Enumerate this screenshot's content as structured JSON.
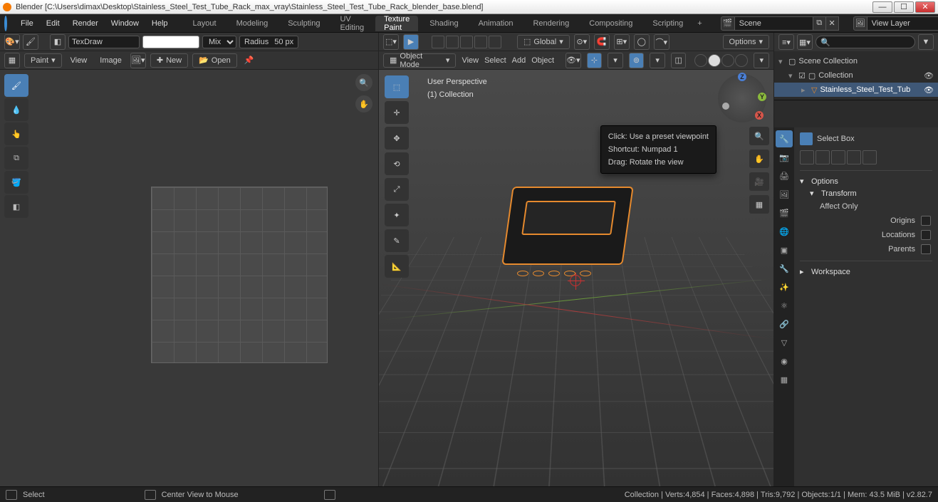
{
  "title": "Blender [C:\\Users\\dimax\\Desktop\\Stainless_Steel_Test_Tube_Rack_max_vray\\Stainless_Steel_Test_Tube_Rack_blender_base.blend]",
  "menu": {
    "file": "File",
    "edit": "Edit",
    "render": "Render",
    "window": "Window",
    "help": "Help"
  },
  "workspaces": {
    "layout": "Layout",
    "modeling": "Modeling",
    "sculpting": "Sculpting",
    "uv": "UV Editing",
    "texture": "Texture Paint",
    "shading": "Shading",
    "animation": "Animation",
    "rendering": "Rendering",
    "compositing": "Compositing",
    "scripting": "Scripting",
    "plus": "+"
  },
  "scene": {
    "label": "Scene",
    "viewlayer": "View Layer"
  },
  "imgeditor": {
    "brush": "TexDraw",
    "blend": "Mix",
    "radius_label": "Radius",
    "radius_val": "50 px",
    "paint": "Paint",
    "view": "View",
    "image": "Image",
    "new": "New",
    "open": "Open"
  },
  "viewport": {
    "mode": "Object Mode",
    "view": "View",
    "select": "Select",
    "add": "Add",
    "object": "Object",
    "orientation": "Global",
    "options": "Options",
    "overlay1": "User Perspective",
    "overlay2": "(1)  Collection"
  },
  "tooltip": {
    "line1": "Click: Use a preset viewpoint",
    "line2": "Shortcut: Numpad 1",
    "line3": "Drag: Rotate the view"
  },
  "outliner": {
    "root": "Scene Collection",
    "coll": "Collection",
    "obj": "Stainless_Steel_Test_Tub"
  },
  "props": {
    "tool": "Select Box",
    "options": "Options",
    "transform": "Transform",
    "affect": "Affect Only",
    "origins": "Origins",
    "locations": "Locations",
    "parents": "Parents",
    "workspace": "Workspace"
  },
  "status": {
    "left1": "Select",
    "left2": "Center View to Mouse",
    "right": "Collection | Verts:4,854 | Faces:4,898 | Tris:9,792 | Objects:1/1 | Mem: 43.5 MiB | v2.82.7"
  },
  "gizmo": {
    "x": "X",
    "y": "Y",
    "z": "Z"
  }
}
